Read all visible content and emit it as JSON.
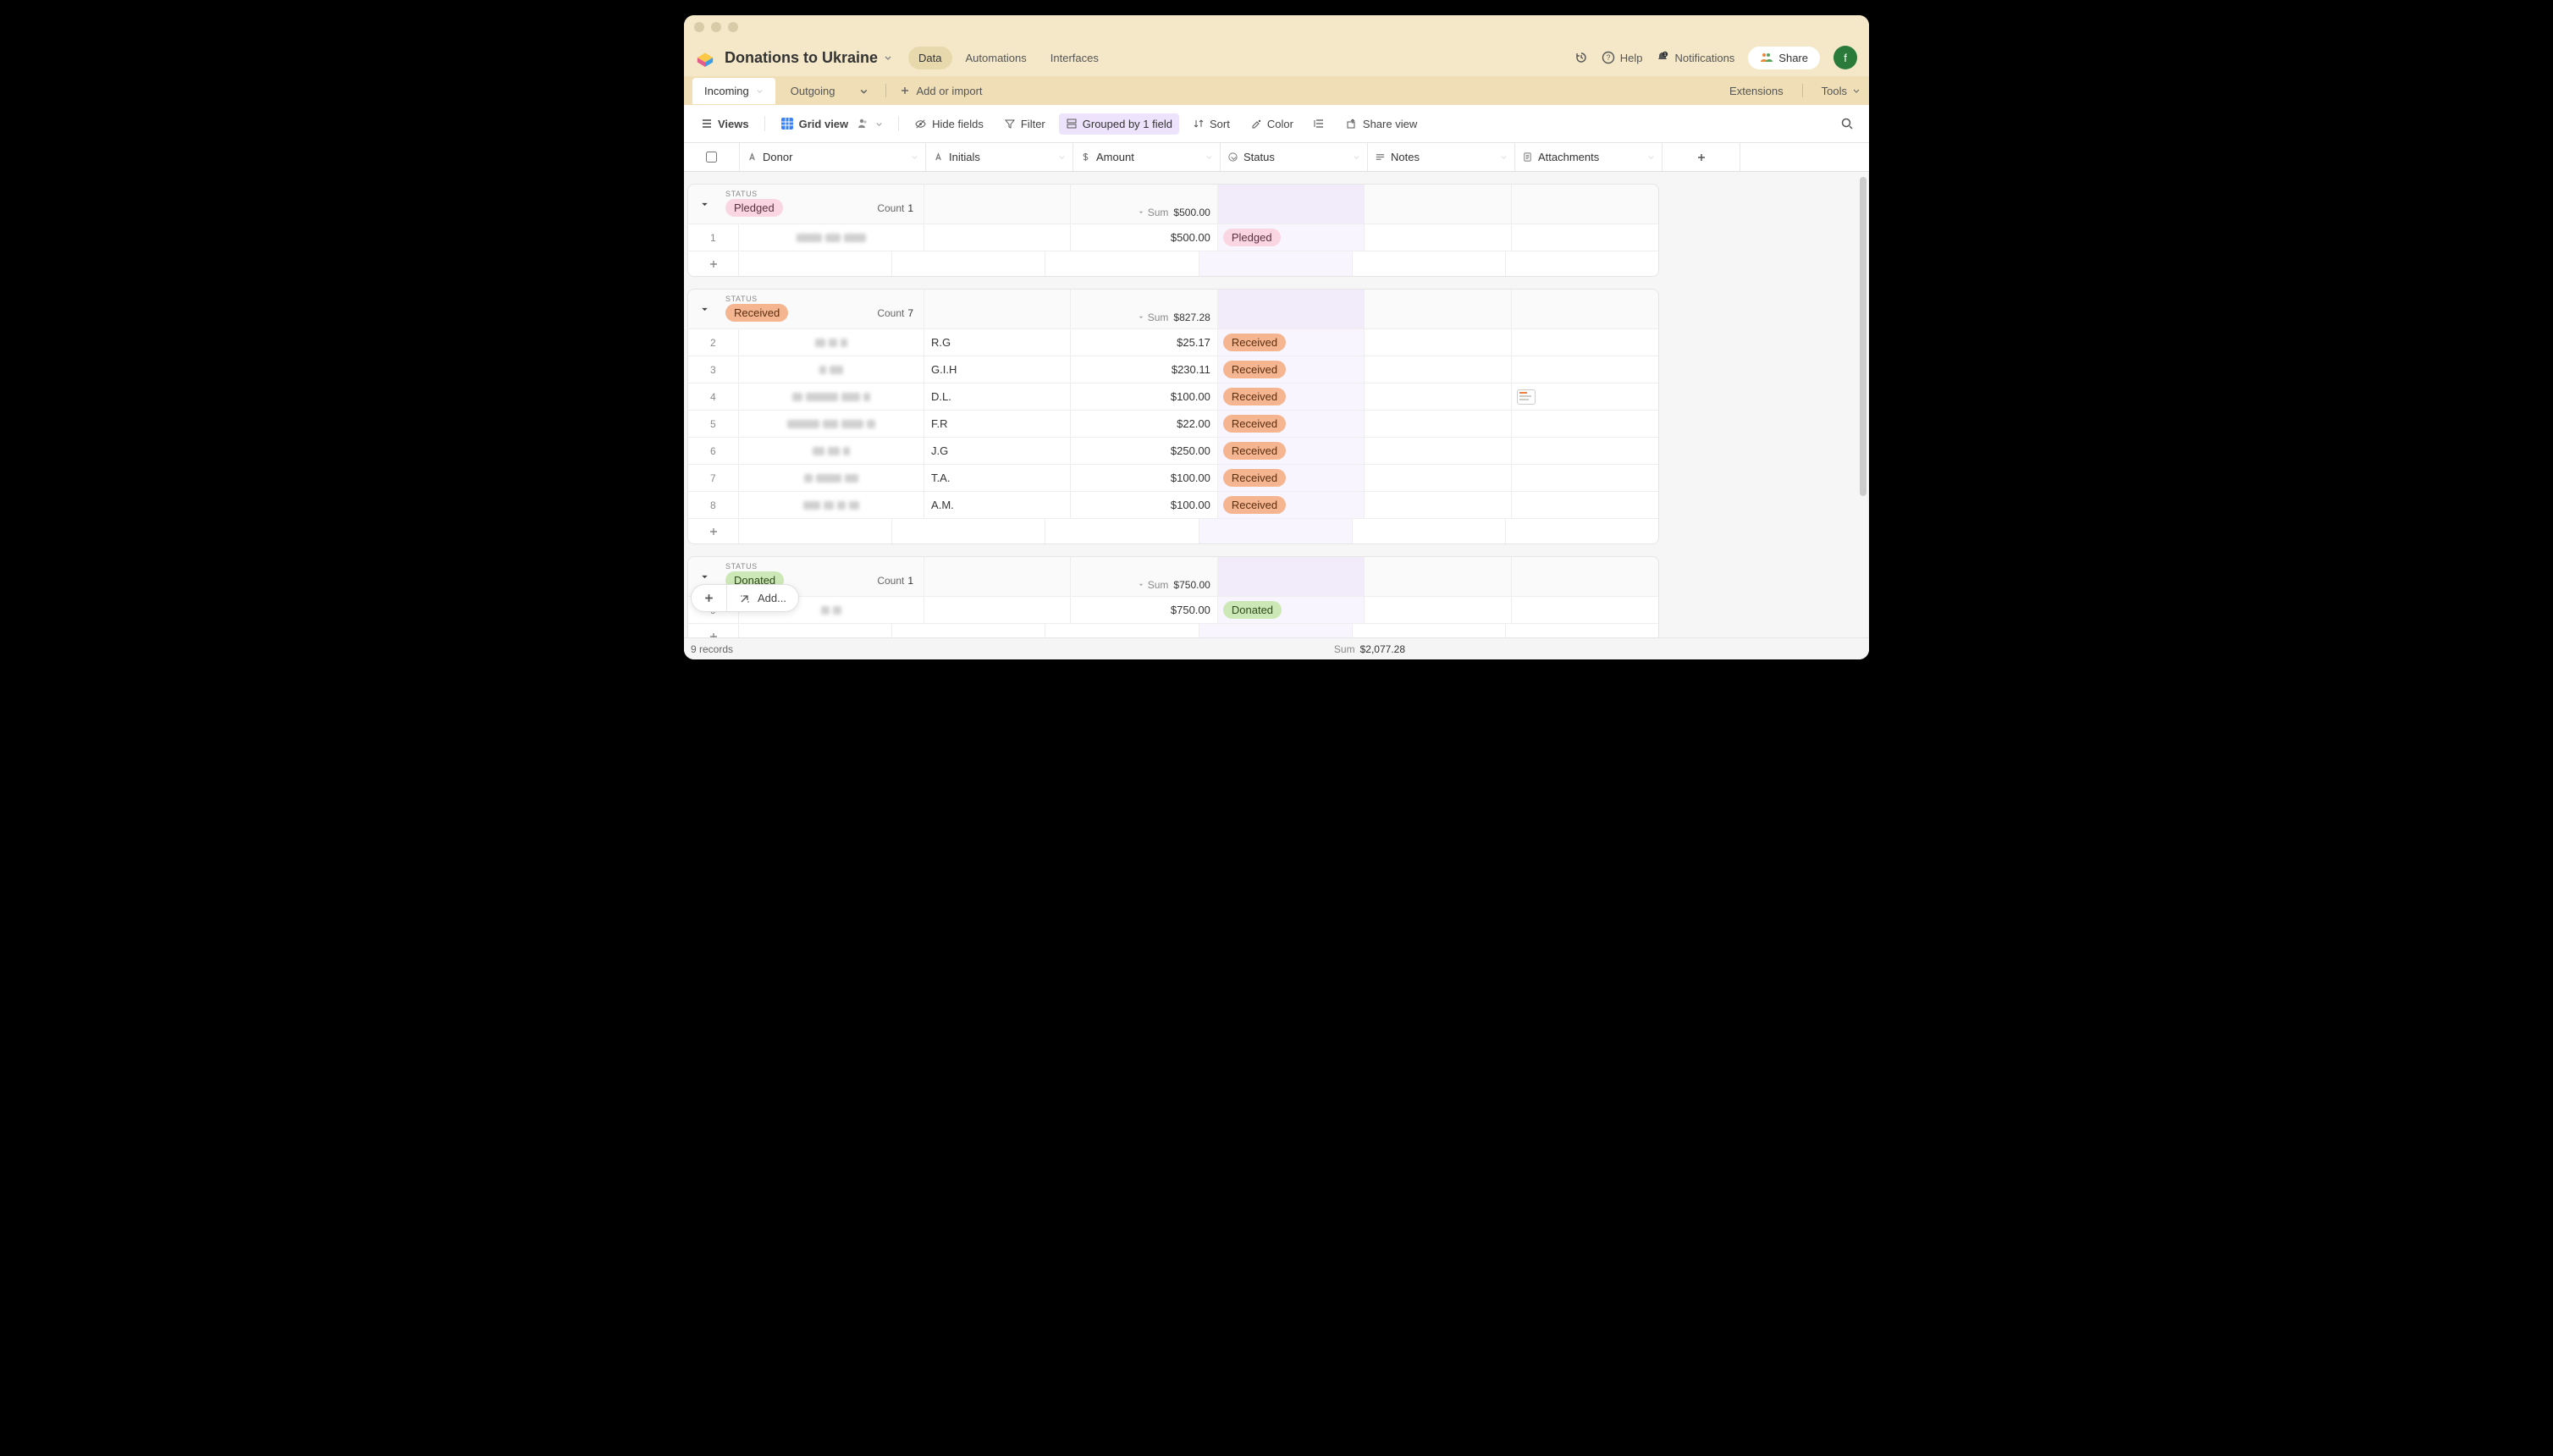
{
  "base_title": "Donations to Ukraine",
  "top_nav": {
    "data": "Data",
    "automations": "Automations",
    "interfaces": "Interfaces"
  },
  "header_right": {
    "help": "Help",
    "notifications": "Notifications",
    "share": "Share",
    "avatar": "f"
  },
  "tables": {
    "incoming": "Incoming",
    "outgoing": "Outgoing",
    "add": "Add or import"
  },
  "right_tabs": {
    "extensions": "Extensions",
    "tools": "Tools"
  },
  "toolbar": {
    "views": "Views",
    "grid_view": "Grid view",
    "hide_fields": "Hide fields",
    "filter": "Filter",
    "grouped": "Grouped by 1 field",
    "sort": "Sort",
    "color": "Color",
    "share_view": "Share view"
  },
  "columns": {
    "donor": "Donor",
    "initials": "Initials",
    "amount": "Amount",
    "status": "Status",
    "notes": "Notes",
    "attachments": "Attachments"
  },
  "group_status_label": "STATUS",
  "count_label": "Count",
  "sum_label": "Sum",
  "groups": [
    {
      "status": "Pledged",
      "pill_class": "pill-pledged",
      "count": "1",
      "sum": "$500.00",
      "rows": [
        {
          "n": "1",
          "initials": "",
          "amount": "$500.00",
          "status": "Pledged",
          "pill_class": "pill-pledged",
          "attach": false
        }
      ]
    },
    {
      "status": "Received",
      "pill_class": "pill-received",
      "count": "7",
      "sum": "$827.28",
      "rows": [
        {
          "n": "2",
          "initials": "R.G",
          "amount": "$25.17",
          "status": "Received",
          "pill_class": "pill-received",
          "attach": false
        },
        {
          "n": "3",
          "initials": "G.I.H",
          "amount": "$230.11",
          "status": "Received",
          "pill_class": "pill-received",
          "attach": false
        },
        {
          "n": "4",
          "initials": "D.L.",
          "amount": "$100.00",
          "status": "Received",
          "pill_class": "pill-received",
          "attach": true
        },
        {
          "n": "5",
          "initials": "F.R",
          "amount": "$22.00",
          "status": "Received",
          "pill_class": "pill-received",
          "attach": false
        },
        {
          "n": "6",
          "initials": "J.G",
          "amount": "$250.00",
          "status": "Received",
          "pill_class": "pill-received",
          "attach": false
        },
        {
          "n": "7",
          "initials": "T.A.",
          "amount": "$100.00",
          "status": "Received",
          "pill_class": "pill-received",
          "attach": false
        },
        {
          "n": "8",
          "initials": "A.M.",
          "amount": "$100.00",
          "status": "Received",
          "pill_class": "pill-received",
          "attach": false
        }
      ]
    },
    {
      "status": "Donated",
      "pill_class": "pill-donated",
      "count": "1",
      "sum": "$750.00",
      "rows": [
        {
          "n": "9",
          "initials": "",
          "amount": "$750.00",
          "status": "Donated",
          "pill_class": "pill-donated",
          "attach": false
        }
      ]
    }
  ],
  "footer": {
    "records": "9 records",
    "sum_label": "Sum",
    "sum_val": "$2,077.28",
    "add": "Add..."
  }
}
